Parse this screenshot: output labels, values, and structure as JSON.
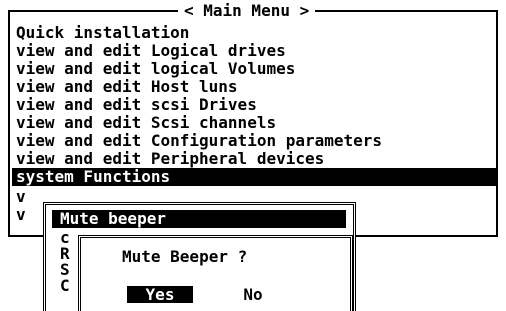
{
  "main_menu": {
    "title": "< Main Menu >",
    "items": [
      "Quick installation",
      "view and edit Logical drives",
      "view and edit logical Volumes",
      "view and edit Host luns",
      "view and edit scsi Drives",
      "view and edit Scsi channels",
      "view and edit Configuration parameters",
      "view and edit Peripheral devices",
      "system Functions",
      "v",
      "v"
    ],
    "selected_index": 8
  },
  "submenu": {
    "title": "Mute beeper",
    "item_letters": [
      "c",
      "R",
      "S",
      "C"
    ]
  },
  "confirm": {
    "question": "Mute Beeper ?",
    "yes_label": "Yes",
    "no_label": "No"
  }
}
